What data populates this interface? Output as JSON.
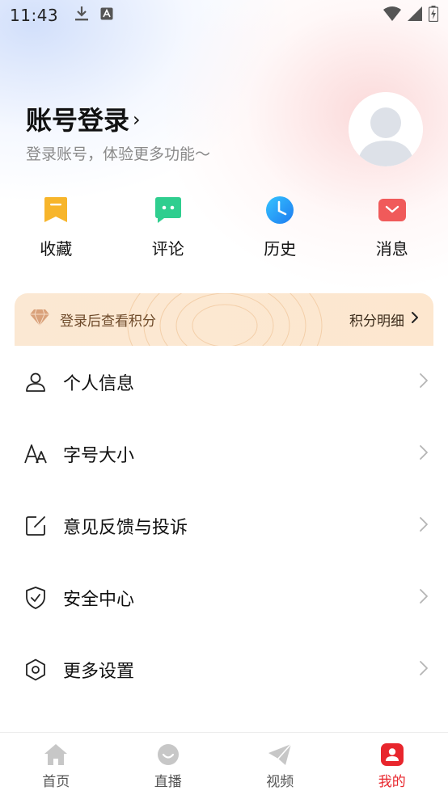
{
  "status_bar": {
    "time": "11:43"
  },
  "account": {
    "title": "账号登录",
    "chevron": "›",
    "subtitle": "登录账号，体验更多功能～"
  },
  "quick_actions": [
    {
      "label": "收藏",
      "icon": "bookmark-icon",
      "color": "#f7b52b"
    },
    {
      "label": "评论",
      "icon": "comment-icon",
      "color": "#2fce8f"
    },
    {
      "label": "历史",
      "icon": "clock-icon",
      "color": "#2196f3"
    },
    {
      "label": "消息",
      "icon": "mail-icon",
      "color": "#f05a5a"
    }
  ],
  "points": {
    "text": "登录后查看积分",
    "detail": "积分明细"
  },
  "menu": [
    {
      "label": "个人信息",
      "icon": "person-icon"
    },
    {
      "label": "字号大小",
      "icon": "font-size-icon"
    },
    {
      "label": "意见反馈与投诉",
      "icon": "edit-icon"
    },
    {
      "label": "安全中心",
      "icon": "shield-icon"
    },
    {
      "label": "更多设置",
      "icon": "settings-icon"
    }
  ],
  "tabbar": [
    {
      "label": "首页",
      "icon": "home-icon",
      "active": false
    },
    {
      "label": "直播",
      "icon": "live-icon",
      "active": false
    },
    {
      "label": "视频",
      "icon": "video-icon",
      "active": false
    },
    {
      "label": "我的",
      "icon": "profile-icon",
      "active": true
    }
  ],
  "colors": {
    "accent": "#e8262d",
    "points_bg": "#fbe8d3"
  }
}
